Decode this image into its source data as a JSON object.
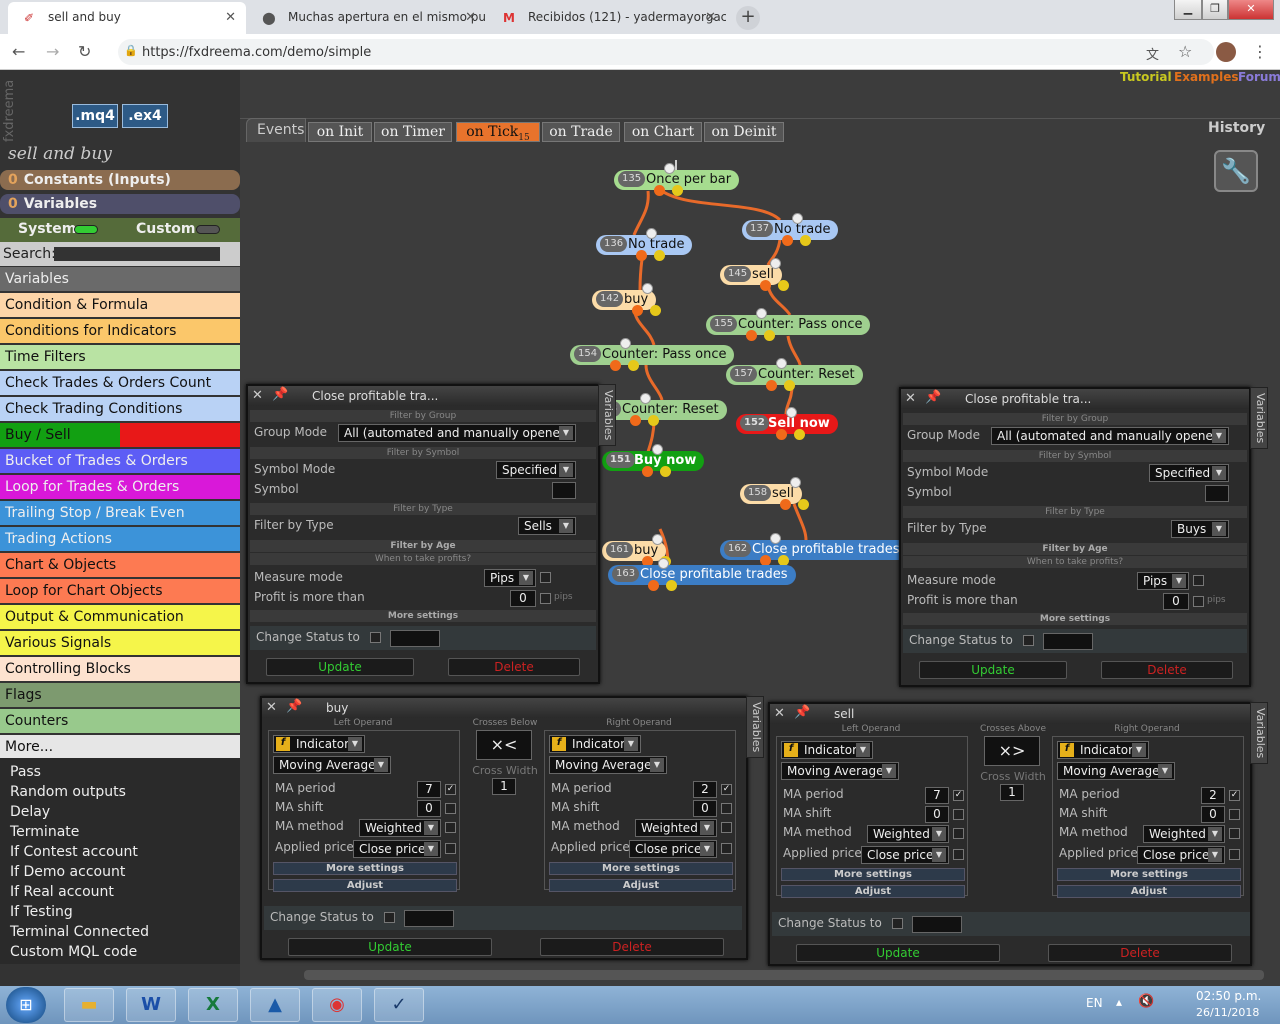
{
  "browser": {
    "tabs": [
      {
        "title": "sell and buy",
        "icon": "fxdreema-icon"
      },
      {
        "title": "Muchas apertura en el mismo pu",
        "icon": "site-icon"
      },
      {
        "title": "Recibidos (121) - yadermayorgac",
        "icon": "gmail-icon"
      }
    ],
    "url": "https://fxdreema.com/demo/simple"
  },
  "header": {
    "tutorial": "Tutorial",
    "examples": "Examples",
    "forum": "Forum",
    "history": "History",
    "mq4": ".mq4",
    "ex4": ".ex4",
    "logo": "fxdreema"
  },
  "sidebar": {
    "project": "sell and buy",
    "constants": "Constants (Inputs)",
    "constants_count": "0",
    "variables": "Variables",
    "variables_count": "0",
    "system": "System",
    "custom": "Custom",
    "search_label": "Search:",
    "categories": [
      {
        "label": "Variables",
        "color": "#6a6a6a"
      },
      {
        "label": "Condition & Formula",
        "color": "#fdd5a8"
      },
      {
        "label": "Conditions for Indicators",
        "color": "#fbc76a"
      },
      {
        "label": "Time Filters",
        "color": "#b9e3a3"
      },
      {
        "label": "Check Trades & Orders Count",
        "color": "#b9d2f5"
      },
      {
        "label": "Check Trading Conditions",
        "color": "#b9d2f5"
      },
      {
        "label": "Buy / Sell",
        "color": "#12a012"
      },
      {
        "label": "Bucket of Trades & Orders",
        "color": "#5d5df5"
      },
      {
        "label": "Loop for Trades & Orders",
        "color": "#d918d9"
      },
      {
        "label": "Trailing Stop / Break Even",
        "color": "#3c93d9"
      },
      {
        "label": "Trading Actions",
        "color": "#3c93d9"
      },
      {
        "label": "Chart & Objects",
        "color": "#fd7a52"
      },
      {
        "label": "Loop for Chart Objects",
        "color": "#fd7a52"
      },
      {
        "label": "Output & Communication",
        "color": "#f5f54a"
      },
      {
        "label": "Various Signals",
        "color": "#f5f54a"
      },
      {
        "label": "Controlling Blocks",
        "color": "#fde2cf"
      },
      {
        "label": "Flags",
        "color": "#7d9a6f"
      },
      {
        "label": "Counters",
        "color": "#98c98c"
      },
      {
        "label": "More...",
        "color": "#e6e6e6"
      }
    ],
    "more_items": [
      "Pass",
      "Random outputs",
      "Delay",
      "Terminate",
      "If Contest account",
      "If Demo account",
      "If Real account",
      "If Testing",
      "Terminal Connected",
      "Custom MQL code"
    ]
  },
  "events": {
    "label": "Events",
    "tabs": [
      "on Init",
      "on Timer",
      "on Tick",
      "on Trade",
      "on Chart",
      "on Deinit"
    ],
    "tick_count": "15",
    "active": "on Tick"
  },
  "nodes": [
    {
      "id": "135",
      "label": "Once per bar",
      "color": "#a6dc8f"
    },
    {
      "id": "136",
      "label": "No trade",
      "color": "#a9c8f3"
    },
    {
      "id": "137",
      "label": "No trade",
      "color": "#a9c8f3"
    },
    {
      "id": "145",
      "label": "sell",
      "color": "#fcdca8"
    },
    {
      "id": "142",
      "label": "buy",
      "color": "#fcdca8"
    },
    {
      "id": "155",
      "label": "Counter: Pass once",
      "color": "#9fd08f"
    },
    {
      "id": "154",
      "label": "Counter: Pass once",
      "color": "#9fd08f"
    },
    {
      "id": "157",
      "label": "Counter: Reset",
      "color": "#9fd08f"
    },
    {
      "id": "153",
      "label": "Counter: Reset",
      "color": "#9fd08f"
    },
    {
      "id": "152",
      "label": "Sell now",
      "color": "#e81818"
    },
    {
      "id": "151",
      "label": "Buy now",
      "color": "#12a012"
    },
    {
      "id": "158",
      "label": "sell",
      "color": "#fcdca8"
    },
    {
      "id": "161",
      "label": "buy",
      "color": "#fcdca8"
    },
    {
      "id": "162",
      "label": "Close profitable trades",
      "color": "#3c7dc5"
    },
    {
      "id": "163",
      "label": "Close profitable trades",
      "color": "#3c7dc5"
    }
  ],
  "close_panel": {
    "title": "Close profitable tra...",
    "filter_group": "Filter by Group",
    "group_mode_label": "Group Mode",
    "group_mode_value": "All (automated and manually opened)",
    "filter_symbol": "Filter by Symbol",
    "symbol_mode_label": "Symbol Mode",
    "symbol_mode_value": "Specified",
    "symbol_label": "Symbol",
    "filter_type_head": "Filter by Type",
    "filter_type_label": "Filter by Type",
    "filter_age": "Filter by Age",
    "when_profit": "When to take profits?",
    "measure_label": "Measure mode",
    "measure_value": "Pips",
    "profit_label": "Profit is more than",
    "profit_value": "0",
    "pips": "pips",
    "more_settings": "More settings",
    "change_status": "Change Status to",
    "update": "Update",
    "delete": "Delete",
    "vertical": "Variables"
  },
  "close_left_type": "Sells",
  "close_right_type": "Buys",
  "ind_panel": {
    "left_operand": "Left Operand",
    "right_operand": "Right Operand",
    "indicator": "Indicator",
    "ma": "Moving Average",
    "ma_period": "MA period",
    "ma_shift": "MA shift",
    "ma_method": "MA method",
    "method_value": "Weighted",
    "applied_price": "Applied price",
    "price_value": "Close price",
    "shift_value": "0",
    "more_settings": "More settings",
    "adjust": "Adjust",
    "cross_width": "Cross Width",
    "cross_width_value": "1",
    "change_status": "Change Status to",
    "update": "Update",
    "delete": "Delete",
    "vertical": "Variables"
  },
  "buy_panel": {
    "title": "buy",
    "crosses": "Crosses Below",
    "symbol": "×<",
    "left_period": "7",
    "right_period": "2"
  },
  "sell_panel": {
    "title": "sell",
    "crosses": "Crosses Above",
    "symbol": "×>",
    "left_period": "7",
    "right_period": "2"
  },
  "taskbar": {
    "lang": "EN",
    "time": "02:50 p.m.",
    "date": "26/11/2018"
  }
}
